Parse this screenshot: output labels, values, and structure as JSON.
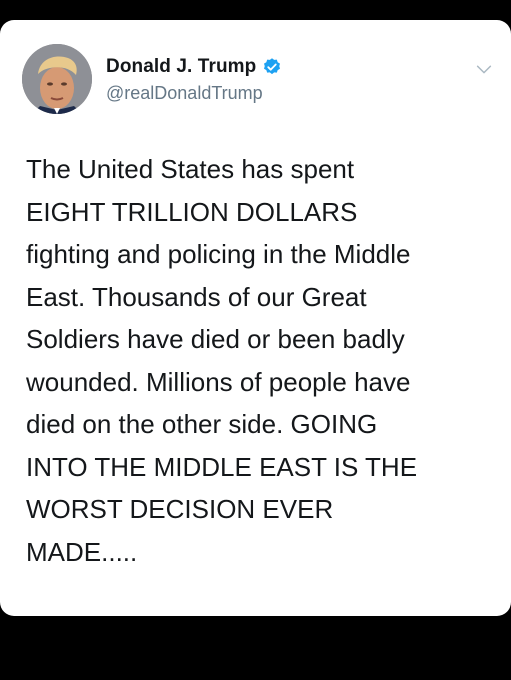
{
  "colors": {
    "background": "#000000",
    "card": "#ffffff",
    "text": "#14171a",
    "secondary_text": "#657786",
    "verified_blue": "#1da1f2"
  },
  "tweet": {
    "author": {
      "display_name": "Donald J. Trump",
      "handle": "@realDonaldTrump",
      "verified": true,
      "avatar_icon": "profile-photo",
      "verified_icon": "verified-badge-icon"
    },
    "menu_icon": "chevron-down-icon",
    "text_lines": [
      "The United States has spent",
      "EIGHT TRILLION DOLLARS",
      "fighting and policing in the Middle",
      "East. Thousands of our Great",
      "Soldiers have died or been badly",
      "wounded. Millions of people have",
      "died on the other side. GOING",
      "INTO THE MIDDLE EAST IS THE",
      "WORST DECISION EVER",
      "MADE....."
    ]
  }
}
